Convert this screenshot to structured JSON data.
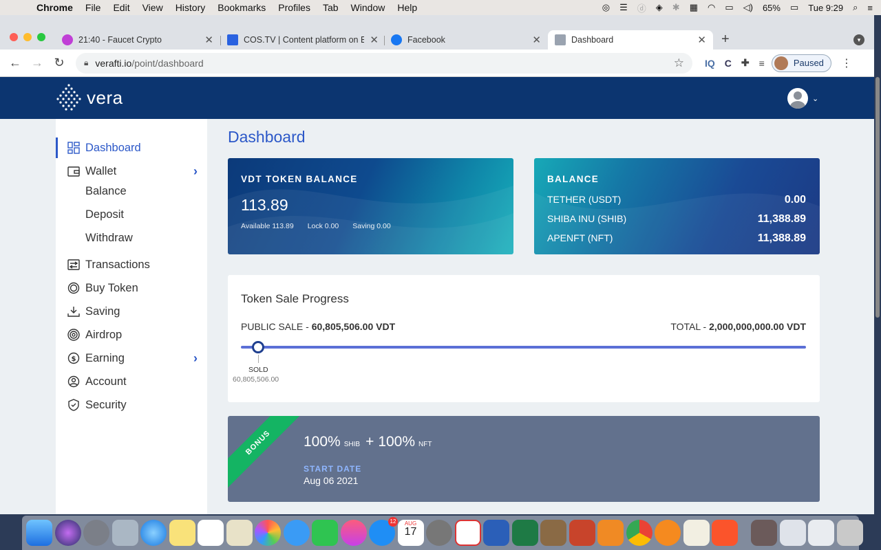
{
  "menubar": {
    "app": "Chrome",
    "items": [
      "File",
      "Edit",
      "View",
      "History",
      "Bookmarks",
      "Profiles",
      "Tab",
      "Window",
      "Help"
    ],
    "battery": "65%",
    "clock": "Tue 9:29"
  },
  "browser": {
    "tabs": [
      {
        "title": "21:40 - Faucet Crypto",
        "favicon_color": "#c03fd6"
      },
      {
        "title": "COS.TV | Content platform on B",
        "favicon_color": "#2a62e0"
      },
      {
        "title": "Facebook",
        "favicon_color": "#1877f2"
      },
      {
        "title": "Dashboard",
        "favicon_color": "#9aa3b0"
      }
    ],
    "url_host": "verafti.io",
    "url_path": "/point/dashboard",
    "profile_status": "Paused"
  },
  "app": {
    "logo_text": "vera",
    "colors": {
      "header": "#0c3570",
      "accent": "#2c58c8",
      "bonus_ribbon": "#14b463"
    },
    "sidebar": {
      "dashboard": "Dashboard",
      "wallet": "Wallet",
      "balance": "Balance",
      "deposit": "Deposit",
      "withdraw": "Withdraw",
      "transactions": "Transactions",
      "buy_token": "Buy Token",
      "saving": "Saving",
      "airdrop": "Airdrop",
      "earning": "Earning",
      "account": "Account",
      "security": "Security"
    },
    "page_title": "Dashboard",
    "vdt": {
      "label": "VDT TOKEN BALANCE",
      "amount": "113.89",
      "available": "Available 113.89",
      "lock": "Lock 0.00",
      "saving": "Saving 0.00"
    },
    "balance": {
      "label": "BALANCE",
      "rows": [
        {
          "name": "TETHER (USDT)",
          "value": "0.00"
        },
        {
          "name": "SHIBA INU (SHIB)",
          "value": "11,388.89"
        },
        {
          "name": "APENFT (NFT)",
          "value": "11,388.89"
        }
      ]
    },
    "sale": {
      "title": "Token Sale Progress",
      "public_label": "PUBLIC SALE - ",
      "public_value": "60,805,506.00 VDT",
      "total_label": "TOTAL - ",
      "total_value": "2,000,000,000.00 VDT",
      "progress_fraction": 0.0304,
      "sold_label": "SOLD",
      "sold_value": "60,805,506.00"
    },
    "bonus": {
      "ribbon": "BONUS",
      "pct1": "100%",
      "unit1": "SHIB",
      "plus": "+",
      "pct2": "100%",
      "unit2": "NFT",
      "start_label": "START DATE",
      "start_date": "Aug 06 2021"
    }
  },
  "dock": {
    "calendar_month": "AUG",
    "calendar_day": "17",
    "appstore_badge": "12"
  }
}
